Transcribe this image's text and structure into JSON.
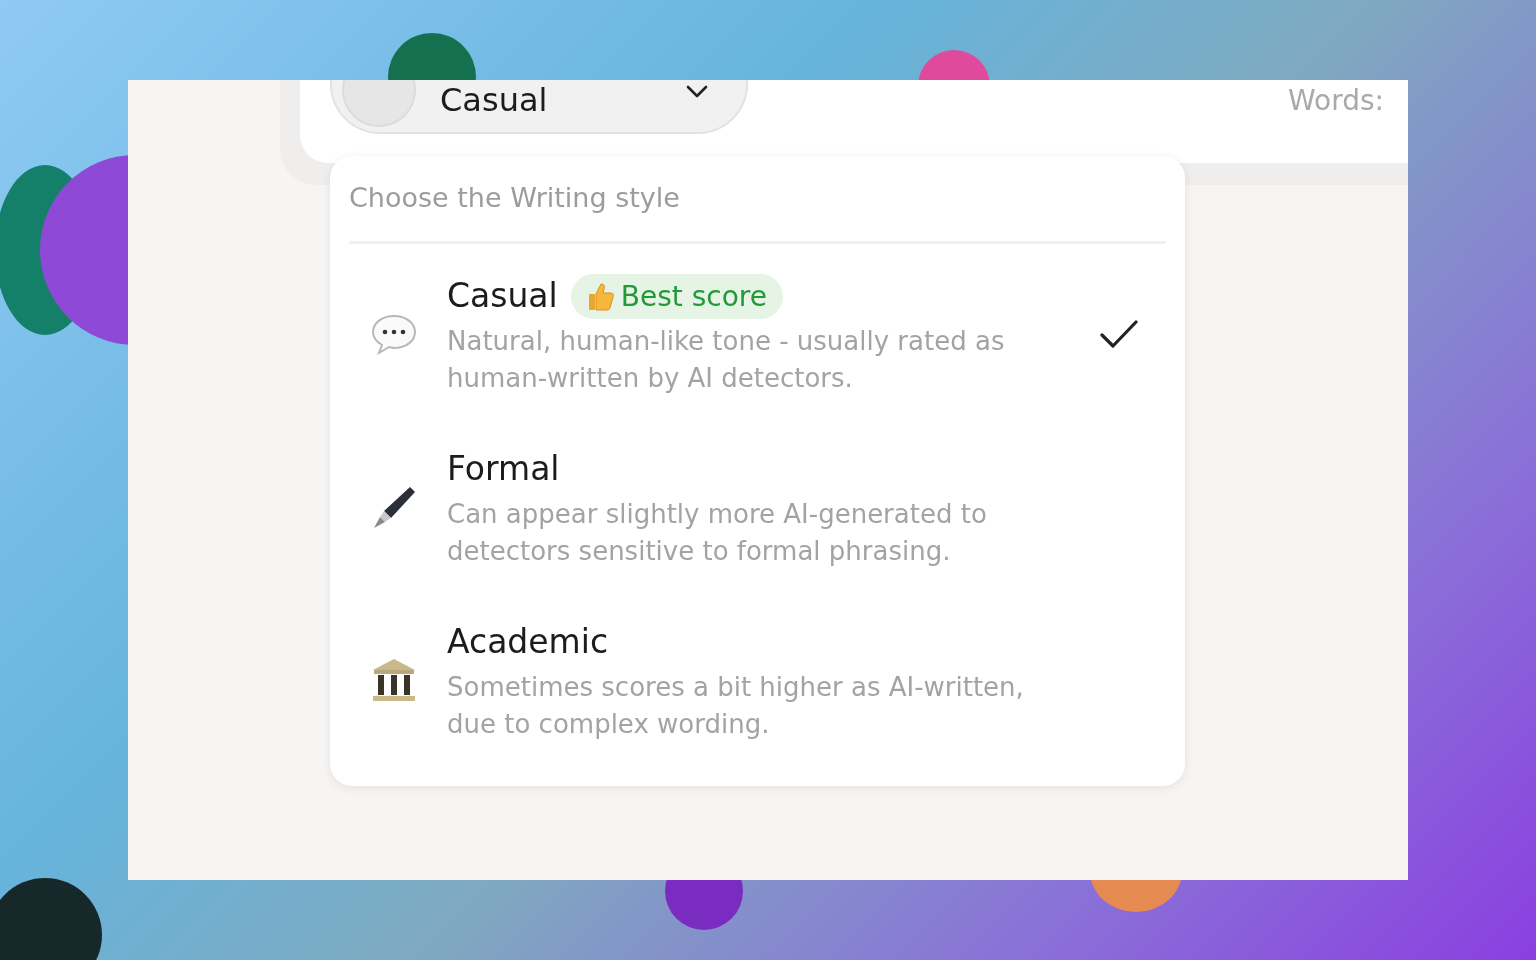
{
  "style_select": {
    "value": "Casual"
  },
  "word_count": {
    "label": "Words:"
  },
  "menu": {
    "title": "Choose the Writing style",
    "options": [
      {
        "kind": "speech",
        "title": "Casual",
        "badge": "Best score",
        "description": "Natural, human-like tone - usually rated as human-written by AI detectors.",
        "selected": true
      },
      {
        "kind": "pen",
        "title": "Formal",
        "description": "Can appear slightly more AI-generated to detectors sensitive to formal phrasing.",
        "selected": false
      },
      {
        "kind": "building",
        "title": "Academic",
        "description": "Sometimes scores a bit higher as AI-written, due to complex wording.",
        "selected": false
      }
    ]
  }
}
